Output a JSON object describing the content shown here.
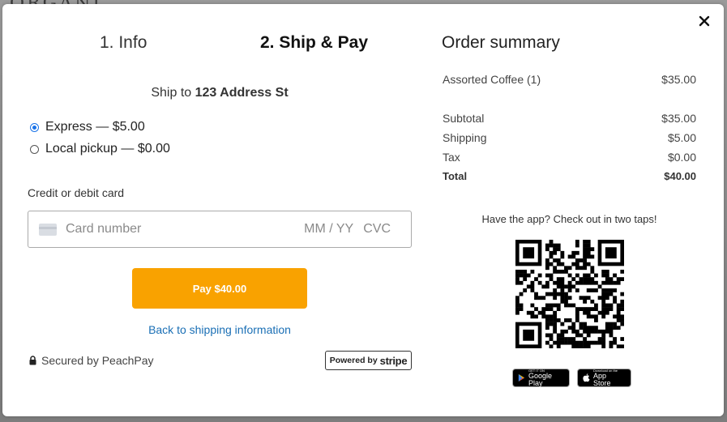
{
  "background": {
    "text": "ORGANI"
  },
  "steps": [
    {
      "label": "1. Info",
      "active": false
    },
    {
      "label": "2. Ship & Pay",
      "active": true
    }
  ],
  "shipping": {
    "prefix": "Ship to",
    "address": "123 Address St",
    "options": [
      {
        "label": "Express — $5.00",
        "selected": true
      },
      {
        "label": "Local pickup — $0.00",
        "selected": false
      }
    ]
  },
  "payment": {
    "card_label": "Credit or debit card",
    "card_number_placeholder": "Card number",
    "expiry_placeholder": "MM / YY",
    "cvc_placeholder": "CVC",
    "pay_button": "Pay $40.00",
    "back_link": "Back to shipping information",
    "secured_text": "Secured by PeachPay",
    "powered_prefix": "Powered by",
    "powered_brand": "stripe"
  },
  "summary": {
    "title": "Order summary",
    "items": [
      {
        "name": "Assorted Coffee (1)",
        "price": "$35.00"
      }
    ],
    "subtotal": {
      "label": "Subtotal",
      "value": "$35.00"
    },
    "shipping": {
      "label": "Shipping",
      "value": "$5.00"
    },
    "tax": {
      "label": "Tax",
      "value": "$0.00"
    },
    "total": {
      "label": "Total",
      "value": "$40.00"
    },
    "app_prompt": "Have the app? Check out in two taps!",
    "stores": {
      "google": {
        "small": "GET IT ON",
        "big": "Google Play"
      },
      "apple": {
        "small": "Download on the",
        "big": "App Store"
      }
    }
  },
  "colors": {
    "accent": "#f9a200",
    "link": "#1a6fb5",
    "radio": "#1a73e8"
  },
  "icons": [
    "close-icon",
    "card-icon",
    "lock-icon",
    "qr-code",
    "google-play-icon",
    "apple-icon"
  ]
}
